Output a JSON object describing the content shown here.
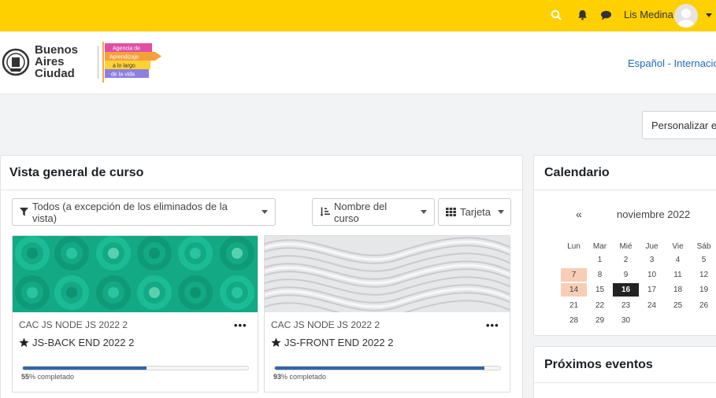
{
  "topbar": {
    "user_name": "Lis Medina",
    "icons": [
      "search-icon",
      "bell-icon",
      "chat-icon",
      "avatar",
      "chevron-down-icon"
    ]
  },
  "brand": {
    "city_lines": [
      "Buenos",
      "Aires",
      "Ciudad"
    ],
    "agency_lines": [
      "Agencia de",
      "Aprendizaje",
      "a lo largo",
      "de la vida"
    ],
    "language_link": "Español - Internacio"
  },
  "customize_button": "Personalizar e",
  "overview": {
    "title": "Vista general de curso",
    "filters": {
      "grouping": "Todos (a excepción de los eliminados de la vista)",
      "sort": "Nombre del curso",
      "view": "Tarjeta"
    },
    "courses": [
      {
        "category": "CAC JS NODE JS 2022 2",
        "name": "JS-BACK END 2022 2",
        "progress_value": "55",
        "progress_suffix": "% completado",
        "progress_fraction": 0.55
      },
      {
        "category": "CAC JS NODE JS 2022 2",
        "name": "JS-FRONT END 2022 2",
        "progress_value": "93",
        "progress_suffix": "% completado",
        "progress_fraction": 0.93
      }
    ]
  },
  "calendar": {
    "title": "Calendario",
    "prev": "«",
    "month": "noviembre 2022",
    "weekdays": [
      "Lun",
      "Mar",
      "Mié",
      "Jue",
      "Vie",
      "Sáb"
    ],
    "weeks": [
      [
        "",
        "1",
        "2",
        "3",
        "4",
        "5"
      ],
      [
        "7",
        "8",
        "9",
        "10",
        "11",
        "12"
      ],
      [
        "14",
        "15",
        "16",
        "17",
        "18",
        "19"
      ],
      [
        "21",
        "22",
        "23",
        "24",
        "25",
        "26"
      ],
      [
        "28",
        "29",
        "30",
        "",
        "",
        ""
      ]
    ],
    "highlighted_days": [
      "7",
      "14"
    ],
    "today": "16"
  },
  "upcoming": {
    "title": "Próximos eventos"
  },
  "colors": {
    "topbar": "#ffd000",
    "progress": "#3266a8",
    "link": "#1f6bb5",
    "calendar_highlight": "#f7cdb5"
  }
}
